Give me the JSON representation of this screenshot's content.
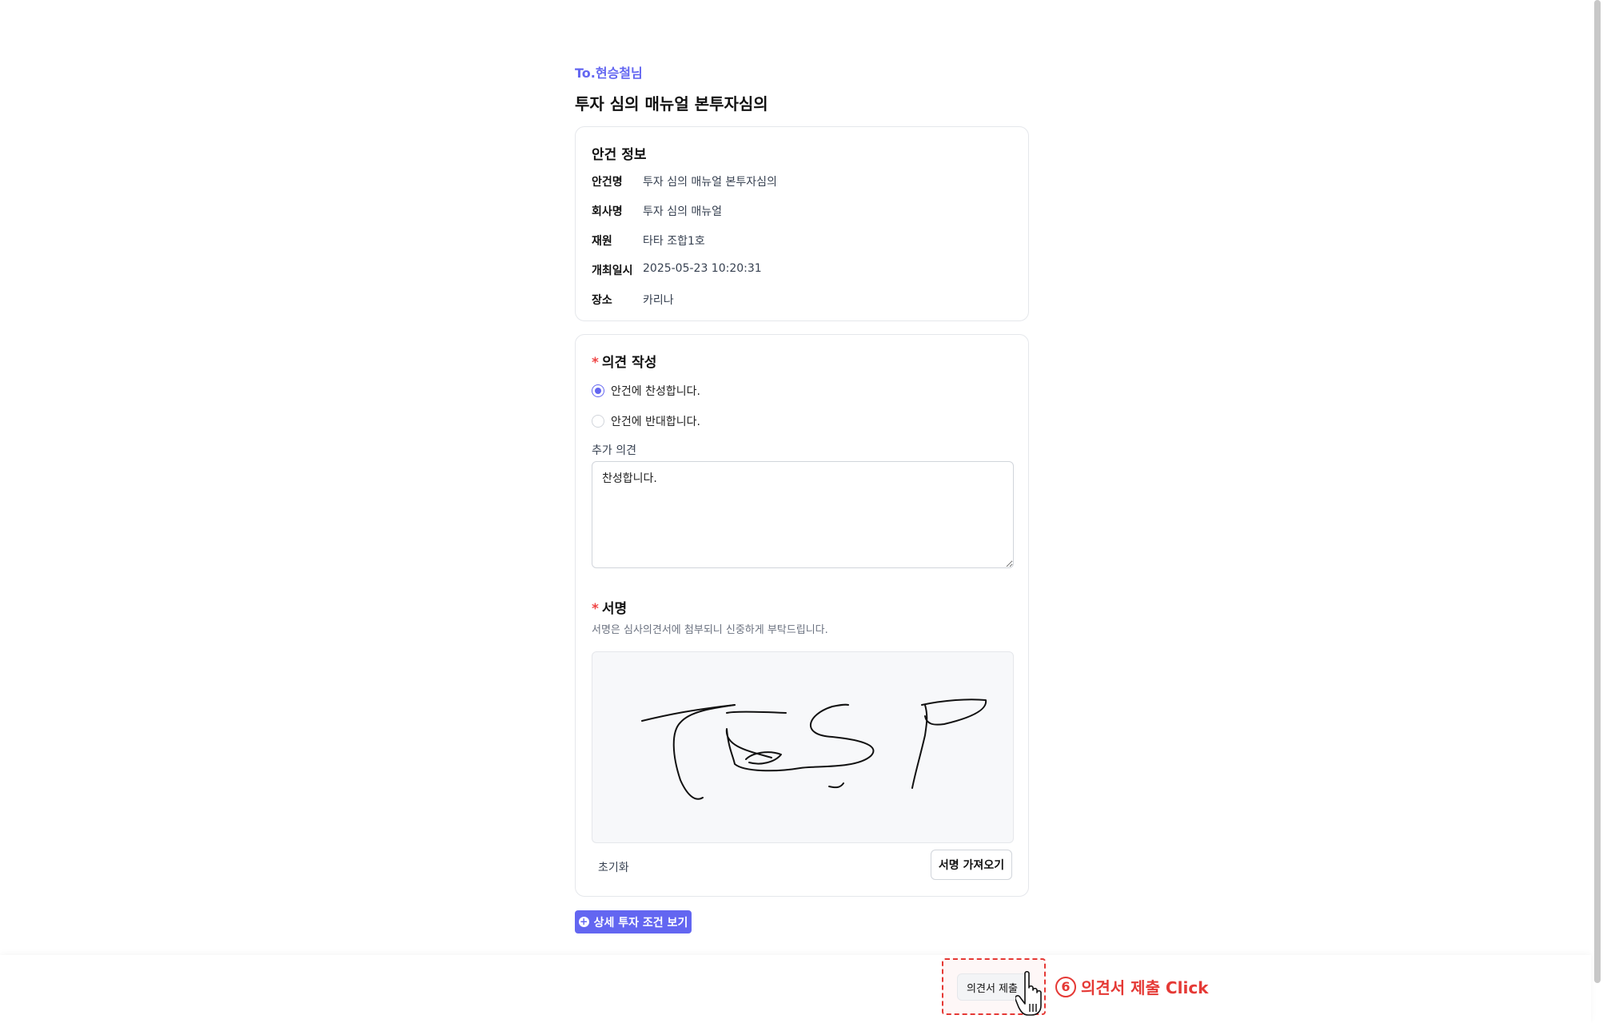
{
  "header": {
    "recipient": "To.현승철님",
    "title": "투자 심의 매뉴얼 본투자심의"
  },
  "agenda_info": {
    "title": "안건 정보",
    "rows": [
      {
        "key": "안건명",
        "value": "투자 심의 매뉴얼 본투자심의"
      },
      {
        "key": "회사명",
        "value": "투자 심의 매뉴얼"
      },
      {
        "key": "재원",
        "value": "타타 조합1호"
      },
      {
        "key": "개최일시",
        "value": "2025-05-23 10:20:31"
      },
      {
        "key": "장소",
        "value": "카리나"
      }
    ]
  },
  "opinion": {
    "required_mark": "*",
    "title": "의견 작성",
    "options": [
      {
        "label": "안건에 찬성합니다.",
        "selected": true
      },
      {
        "label": "안건에 반대합니다.",
        "selected": false
      }
    ],
    "additional_label": "추가 의견",
    "additional_value": "찬성합니다."
  },
  "signature": {
    "required_mark": "*",
    "title": "서명",
    "help": "서명은 심사의견서에 첨부되니 신중하게 부탁드립니다.",
    "reset_label": "초기화",
    "import_label": "서명 가져오기"
  },
  "terms_button": {
    "label": "상세 투자 조건 보기",
    "icon": "plus-circle-icon"
  },
  "footer": {
    "submit_label": "의견서 제출"
  },
  "annotation": {
    "step": "6",
    "text": "의견서 제출 Click",
    "color": "#e53935"
  },
  "colors": {
    "accent": "#6366f1",
    "required": "#ef4444"
  }
}
